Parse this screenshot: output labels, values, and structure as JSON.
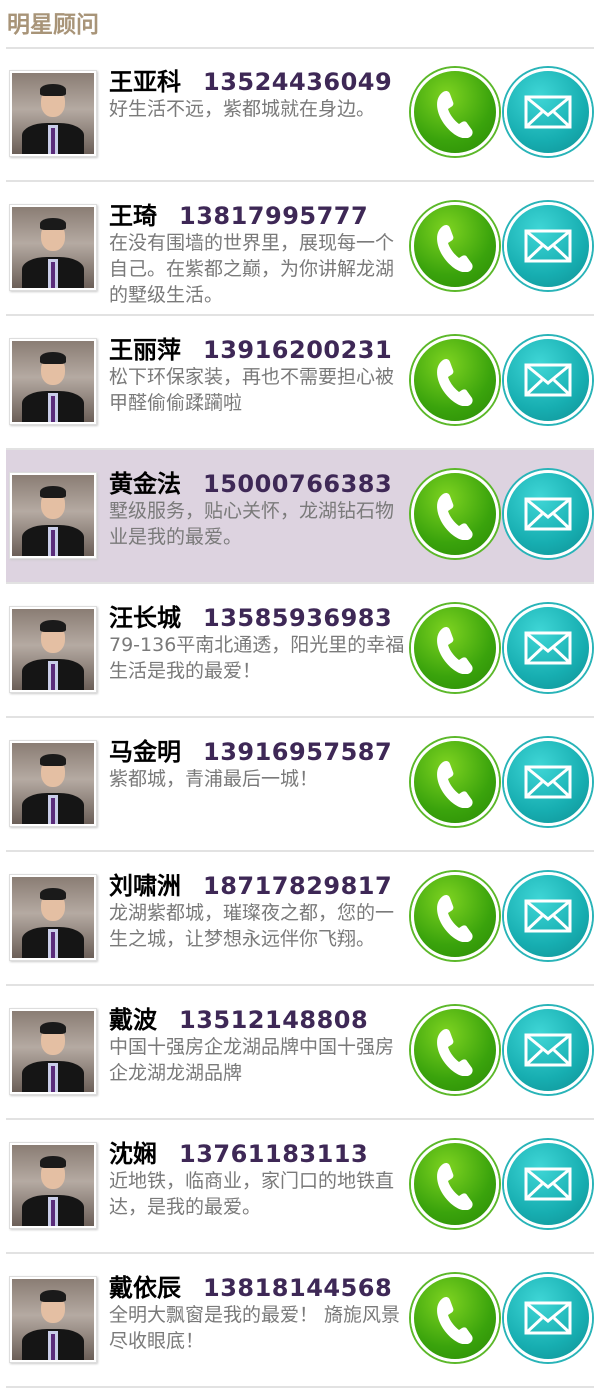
{
  "header": {
    "title": "明星顾问"
  },
  "advisors": [
    {
      "name": "王亚科",
      "phone": "13524436049",
      "desc": "好生活不远，紫都城就在身边。"
    },
    {
      "name": "王琦",
      "phone": "13817995777",
      "desc": "在没有围墙的世界里，展现每一个自己。在紫都之巅，为你讲解龙湖的墅级生活。"
    },
    {
      "name": "王丽萍",
      "phone": "13916200231",
      "desc": "松下环保家装，再也不需要担心被甲醛偷偷蹂躏啦"
    },
    {
      "name": "黄金法",
      "phone": "15000766383",
      "desc": "墅级服务，贴心关怀，龙湖钻石物业是我的最爱。"
    },
    {
      "name": "汪长城",
      "phone": "13585936983",
      "desc": "79-136平南北通透，阳光里的幸福生活是我的最爱！"
    },
    {
      "name": "马金明",
      "phone": "13916957587",
      "desc": "紫都城，青浦最后一城！"
    },
    {
      "name": "刘啸洲",
      "phone": "18717829817",
      "desc": "龙湖紫都城，璀璨夜之都，您的一生之城，让梦想永远伴你飞翔。"
    },
    {
      "name": "戴波",
      "phone": "13512148808",
      "desc": "中国十强房企龙湖品牌中国十强房企龙湖龙湖品牌"
    },
    {
      "name": "沈娴",
      "phone": "13761183113",
      "desc": "近地铁，临商业，家门口的地铁直达，是我的最爱。"
    },
    {
      "name": "戴依辰",
      "phone": "13818144568",
      "desc": "全明大飘窗是我的最爱！ 旖旎风景尽收眼底！"
    }
  ],
  "highlighted_index": 3,
  "icons": {
    "call": "phone-icon",
    "mail": "envelope-icon"
  }
}
